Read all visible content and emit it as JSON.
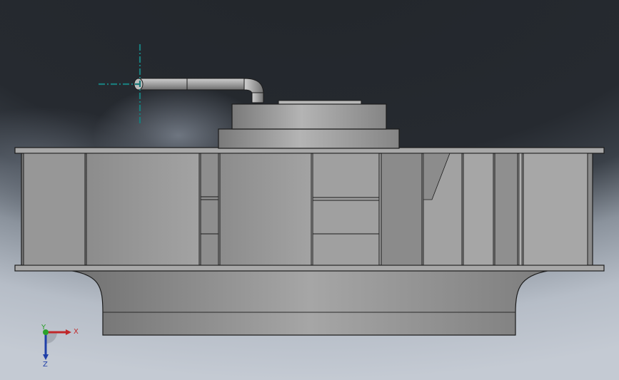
{
  "viewport": {
    "triad": {
      "x_label": "X",
      "y_label": "Y",
      "z_label": "Z",
      "x_color": "#c0282a",
      "y_color": "#2aa12a",
      "z_color": "#1f3fa8"
    },
    "background_top_color": "#262a30",
    "background_bottom_color": "#c4cad3",
    "model_body_color": "#9a9a9a",
    "model_edge_color": "#1c1c1c",
    "origin_marker_color": "#1a7a7a"
  }
}
